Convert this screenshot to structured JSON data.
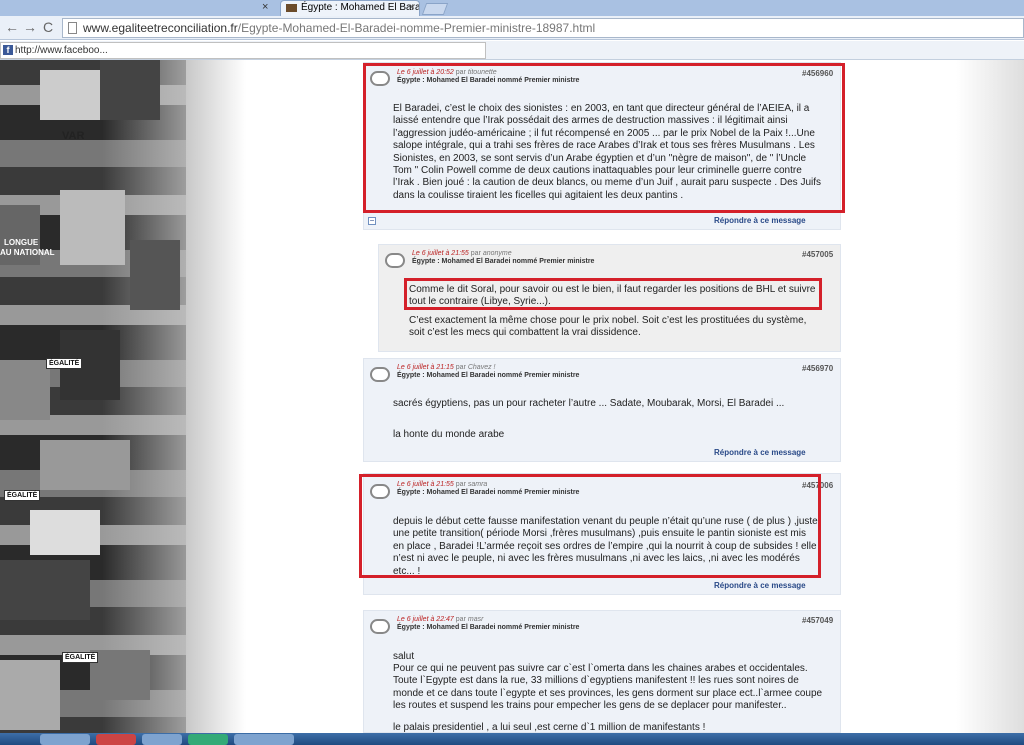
{
  "browser": {
    "tab_close_prev": "×",
    "tab_title": "Égypte : Mohamed El Bara",
    "tab_close": "×",
    "back": "←",
    "forward": "→",
    "reload": "C",
    "url_domain": "www.egaliteetreconciliation.fr",
    "url_path": "/Egypte-Mohamed-El-Baradei-nomme-Premier-ministre-18987.html",
    "bookmark_field": "http://www.faceboo...",
    "fb": "f"
  },
  "collage": {
    "text1": "VAR",
    "text2": "LONGUE",
    "text3": "AU NATIONAL",
    "badge1": "ÉGALITÉ",
    "badge2": "ÉGALITÉ",
    "badge3": "ÉGALITÉ"
  },
  "comments": [
    {
      "date": "Le 6 juillet à 20:52",
      "par": "par",
      "author": "titounette",
      "subject": "Égypte : Mohamed El Baradei nommé Premier ministre",
      "id": "#456960",
      "body": "El Baradei, c’est le choix des sionistes : en 2003, en tant que directeur général de l’AEIEA, il a laissé entendre que l’Irak possédait des armes de destruction massives : il légitimait ainsi l’aggression judéo-américaine ; il fut récompensé en 2005 ... par le prix Nobel de la Paix !...Une salope intégrale, qui a trahi ses frères de race Arabes d’Irak et tous ses frères Musulmans . Les Sionistes, en 2003, se sont servis d’un Arabe égyptien et d’un \"nègre de maison\", de \" l’Uncle Tom \" Colin Powell comme de deux cautions inattaquables pour leur criminelle guerre contre l’Irak . Bien joué : la caution de deux blancs, ou meme d’un Juif , aurait paru suspecte . Des Juifs dans la coulisse tiraient les ficelles qui agitaient les deux pantins .",
      "reply": "Répondre à ce message",
      "minus": "−"
    },
    {
      "date": "Le 6 juillet à 21:55",
      "par": "par",
      "author": "anonyme",
      "subject": "Égypte : Mohamed El Baradei nommé Premier ministre",
      "id": "#457005",
      "body1": "Comme le dit Soral, pour savoir ou est le bien, il faut regarder les positions de BHL et suivre tout le contraire (Libye, Syrie...).",
      "body2": "C’est exactement la même chose pour le prix nobel. Soit c’est les prostituées du système, soit c’est les mecs qui combattent la vrai dissidence."
    },
    {
      "date": "Le 6 juillet à 21:15",
      "par": "par",
      "author": "Chavez !",
      "subject": "Égypte : Mohamed El Baradei nommé Premier ministre",
      "id": "#456970",
      "body1": "sacrés égyptiens, pas un pour racheter l’autre ... Sadate, Moubarak, Morsi, El Baradei ...",
      "body2": "la honte du monde arabe",
      "reply": "Répondre à ce message"
    },
    {
      "date": "Le 6 juillet à 21:55",
      "par": "par",
      "author": "samra",
      "subject": "Égypte : Mohamed El Baradei nommé Premier ministre",
      "id": "#457006",
      "body": "depuis le début cette fausse manifestation venant du peuple n’était qu’une ruse ( de plus ) ,juste une petite transition( période Morsi ,frères musulmans) ,puis ensuite le pantin sioniste est mis en place , Baradei !L’armée reçoit ses ordres de l’empire ,qui la nourrit à coup de subsides ! elle n’est ni avec le peuple, ni avec les frères musulmans ,ni avec les laics, ,ni avec les modérés etc... !",
      "reply": "Répondre à ce message"
    },
    {
      "date": "Le 6 juillet à 22:47",
      "par": "par",
      "author": "masr",
      "subject": "Égypte : Mohamed El Baradei nommé Premier ministre",
      "id": "#457049",
      "body1": "salut",
      "body2": "Pour ce qui ne peuvent pas suivre car c`est l`omerta dans les chaines arabes et occidentales. Toute l`Egypte est dans la rue, 33 millions d`egyptiens manifestent !! les rues sont noires de monde et ce dans toute l`egypte et ses provinces, les gens dorment sur place ect..l`armee coupe les routes et suspend les trains pour empecher les gens de se deplacer pour manifester..",
      "body3": "le palais presidentiel , a lui seul ,est cerne d`1 million de manifestants !"
    }
  ]
}
